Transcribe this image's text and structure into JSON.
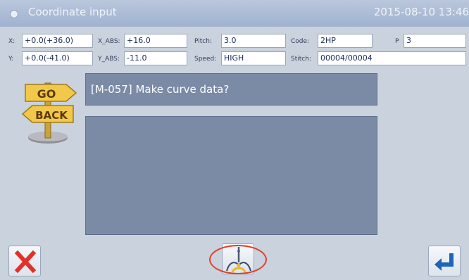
{
  "titlebar": {
    "title": "Coordinate input",
    "datetime": "2015-08-10 13:46"
  },
  "info": {
    "x": {
      "label": "X:",
      "value": "+0.0(+36.0)"
    },
    "y": {
      "label": "Y:",
      "value": "+0.0(-41.0)"
    },
    "x_abs": {
      "label": "X_ABS:",
      "value": "+16.0"
    },
    "y_abs": {
      "label": "Y_ABS:",
      "value": "-11.0"
    },
    "pitch": {
      "label": "Pitch:",
      "value": "3.0"
    },
    "speed": {
      "label": "Speed:",
      "value": "HIGH"
    },
    "code": {
      "label": "Code:",
      "value": "2HP"
    },
    "p": {
      "label": "P",
      "value": "3"
    },
    "stitch": {
      "label": "Stitch:",
      "value": "00004/00004"
    }
  },
  "go_back": {
    "top": "GO",
    "bottom": "BACK"
  },
  "message": {
    "text": "[M-057] Make curve data?"
  },
  "buttons": {
    "cancel": {
      "icon": "red-x-icon"
    },
    "curve": {
      "icon": "needle-curve-icon"
    },
    "enter": {
      "icon": "enter-arrow-icon"
    }
  },
  "colors": {
    "accent_ring": "#e0402a",
    "panel": "#7b8aa5",
    "background": "#c9d2dd"
  }
}
